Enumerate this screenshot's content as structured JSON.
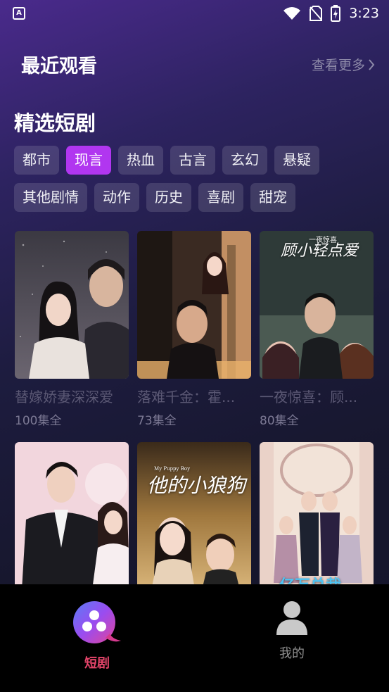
{
  "status_bar": {
    "time": "3:23",
    "app_icon_letter": "A"
  },
  "recent": {
    "title": "最近观看",
    "more_label": "查看更多"
  },
  "featured": {
    "title": "精选短剧",
    "categories_row1": [
      "都市",
      "现言",
      "热血",
      "古言",
      "玄幻",
      "悬疑"
    ],
    "categories_row2": [
      "其他剧情",
      "动作",
      "历史",
      "喜剧",
      "甜宠"
    ],
    "active_category": "现言"
  },
  "dramas": [
    {
      "title": "替嫁娇妻深深爱",
      "episodes": "100集全"
    },
    {
      "title": "落难千金：霍...",
      "episodes": "73集全"
    },
    {
      "title": "一夜惊喜：顾...",
      "episodes": "80集全"
    },
    {
      "title": "",
      "episodes": ""
    },
    {
      "title": "",
      "episodes": ""
    },
    {
      "title": "",
      "episodes": ""
    }
  ],
  "posters": {
    "p3_title": "顾小轻点爱",
    "p3_sub": "一夜惊喜",
    "p5_title": "他的小狼狗",
    "p5_sub": "My Puppy Boy",
    "p6_title": "亿万总裁"
  },
  "tabs": {
    "home_label": "短剧",
    "mine_label": "我的"
  },
  "colors": {
    "accent": "#b136f0",
    "tab_active": "#e6456b"
  }
}
